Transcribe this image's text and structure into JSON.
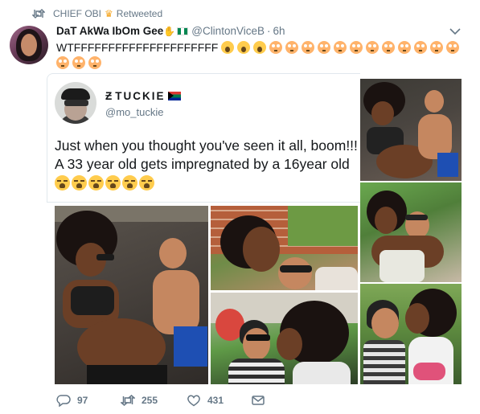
{
  "retweet_bar": {
    "retweeter_name": "CHIEF OBI",
    "crown_icon": "crown-emoji",
    "label": "Retweeted"
  },
  "tweet": {
    "display_name": "DaT AkWa IbOm Gee",
    "badge_emojis": [
      "raised-hand-emoji",
      "nigeria-flag-emoji"
    ],
    "handle": "@ClintonViceB",
    "separator": "·",
    "time": "6h",
    "text": "WTFFFFFFFFFFFFFFFFFFFFF",
    "text_emojis": [
      "screaming-face",
      "screaming-face",
      "screaming-face",
      "flushed-face",
      "flushed-face",
      "flushed-face",
      "flushed-face",
      "flushed-face",
      "flushed-face",
      "flushed-face",
      "flushed-face",
      "flushed-face",
      "flushed-face",
      "flushed-face",
      "flushed-face",
      "flushed-face",
      "flushed-face",
      "flushed-face"
    ]
  },
  "quoted_tweet": {
    "display_name": "TUCKIE",
    "name_prefix": "Ƶ",
    "flag_icon": "south-africa-flag-emoji",
    "handle": "@mo_tuckie",
    "text": "Just when you thought you've seen it all, boom!!! A 33 year old gets impregnated by a 16year old",
    "text_emojis": [
      "loudly-crying-face",
      "loudly-crying-face",
      "loudly-crying-face",
      "loudly-crying-face",
      "loudly-crying-face",
      "loudly-crying-face"
    ],
    "photos": [
      "couple-on-lounge-chairs-1",
      "couple-hug-garden",
      "couple-kissing-close",
      "couple-on-lounge-chairs-main",
      "couple-selfie-brick-wall",
      "couple-kiss-outdoor"
    ]
  },
  "actions": {
    "reply_count": "97",
    "retweet_count": "255",
    "like_count": "431",
    "dm_icon": "envelope-icon"
  },
  "colors": {
    "text": "#14171a",
    "muted": "#657786",
    "border": "#e1e8ed"
  }
}
